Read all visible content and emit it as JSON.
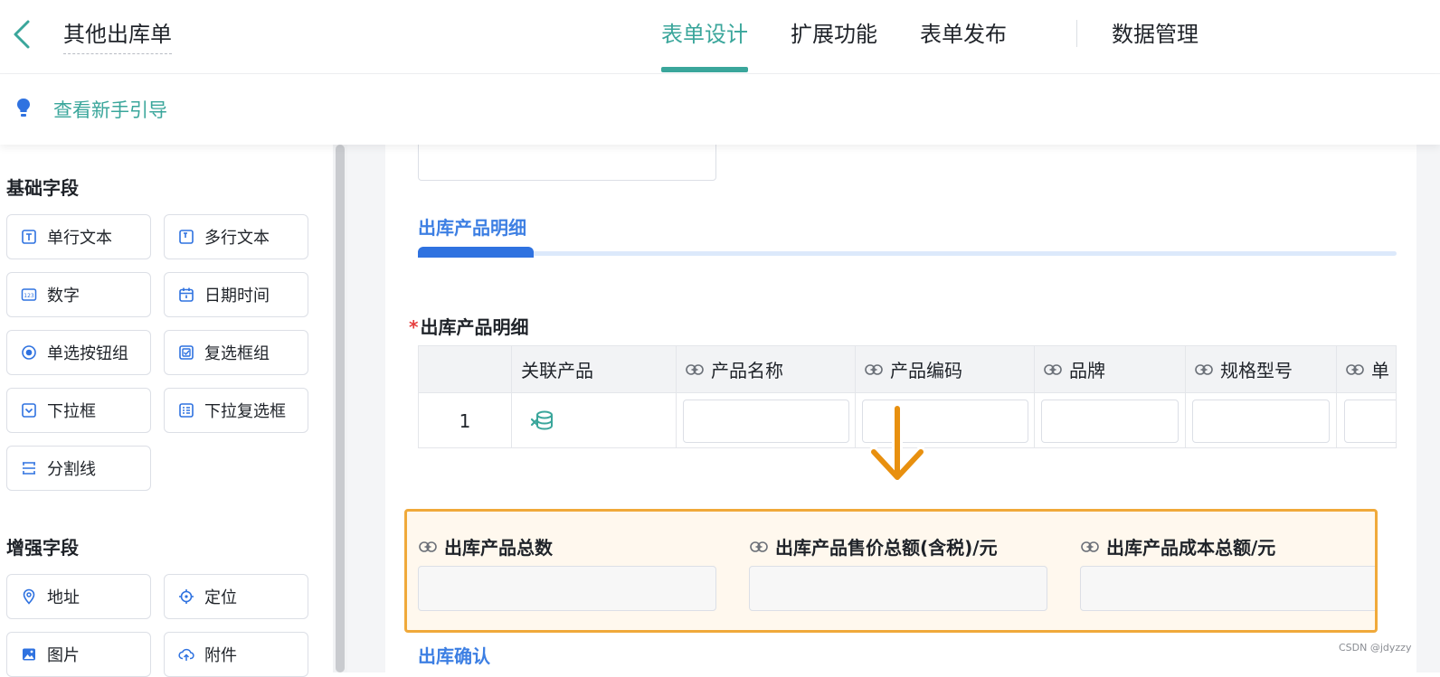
{
  "header": {
    "back_icon": "chevron-left-icon",
    "title": "其他出库单",
    "tabs": [
      {
        "label": "表单设计",
        "active": true
      },
      {
        "label": "扩展功能",
        "active": false
      },
      {
        "label": "表单发布",
        "active": false
      },
      {
        "label": "数据管理",
        "active": false
      }
    ],
    "accent_color": "#3aa69b"
  },
  "guide": {
    "icon": "lightbulb-icon",
    "link": "查看新手引导"
  },
  "sidebar": {
    "basic_title": "基础字段",
    "basic_fields": [
      {
        "label": "单行文本",
        "icon": "text-field-icon"
      },
      {
        "label": "多行文本",
        "icon": "textarea-icon"
      },
      {
        "label": "数字",
        "icon": "number-icon"
      },
      {
        "label": "日期时间",
        "icon": "calendar-icon"
      },
      {
        "label": "单选按钮组",
        "icon": "radio-icon"
      },
      {
        "label": "复选框组",
        "icon": "checkbox-icon"
      },
      {
        "label": "下拉框",
        "icon": "dropdown-icon"
      },
      {
        "label": "下拉复选框",
        "icon": "multi-select-icon"
      },
      {
        "label": "分割线",
        "icon": "divider-icon"
      }
    ],
    "enhanced_title": "增强字段",
    "enhanced_fields": [
      {
        "label": "地址",
        "icon": "location-pin-icon"
      },
      {
        "label": "定位",
        "icon": "crosshair-icon"
      },
      {
        "label": "图片",
        "icon": "image-icon"
      },
      {
        "label": "附件",
        "icon": "upload-cloud-icon"
      }
    ]
  },
  "form": {
    "subtab_label": "出库产品明细",
    "table_title": "出库产品明细",
    "required_mark": "*",
    "columns": [
      "关联产品",
      "产品名称",
      "产品编码",
      "品牌",
      "规格型号",
      "单"
    ],
    "row_number": "1",
    "summary": {
      "fields": [
        "出库产品总数",
        "出库产品售价总额(含税)/元",
        "出库产品成本总额/元"
      ],
      "highlight_color": "#f0a93a"
    },
    "next_section": "出库确认"
  },
  "watermark": "CSDN @jdyzzy"
}
